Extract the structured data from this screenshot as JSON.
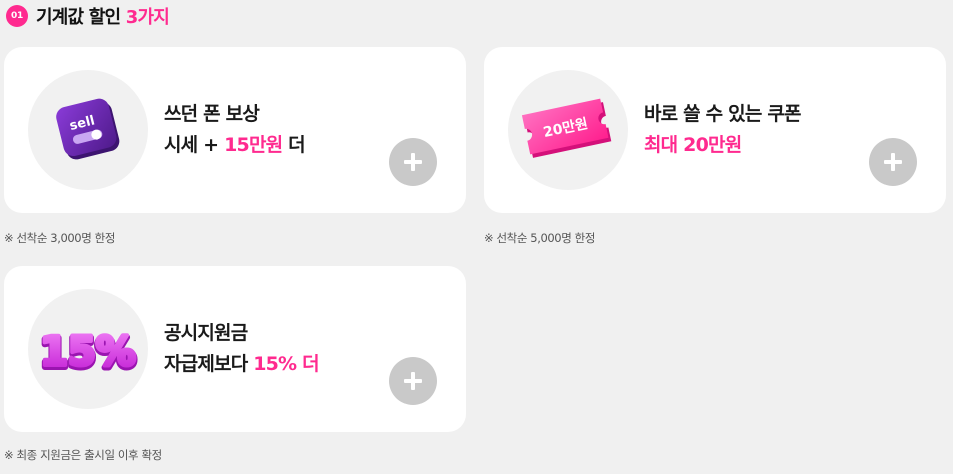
{
  "section": {
    "badge": "01",
    "title_main": "기계값 할인",
    "title_accent": "3가지"
  },
  "cards": [
    {
      "icon": "sell-icon",
      "line1": "쓰던 폰 보상",
      "line2_pre": "시세 + ",
      "line2_accent": "15만원",
      "line2_post": " 더",
      "icon_text": "sell",
      "note": "※ 선착순 3,000명 한정"
    },
    {
      "icon": "coupon-icon",
      "line1": "바로 쓸 수 있는 쿠폰",
      "line2_accent": "최대 20만원",
      "icon_text": "20만원",
      "note": "※ 선착순 5,000명 한정"
    },
    {
      "icon": "percent-balloon-icon",
      "line1": "공시지원금",
      "line2_pre": "자급제보다 ",
      "line2_accent": "15% 더",
      "icon_text": "15%",
      "note": "※ 최종 지원금은 출시일 이후 확정"
    }
  ],
  "colors": {
    "accent": "#ff2a8f",
    "card_bg": "#ffffff",
    "page_bg": "#f0f0f0",
    "plus_button": "#c9c9c9"
  }
}
